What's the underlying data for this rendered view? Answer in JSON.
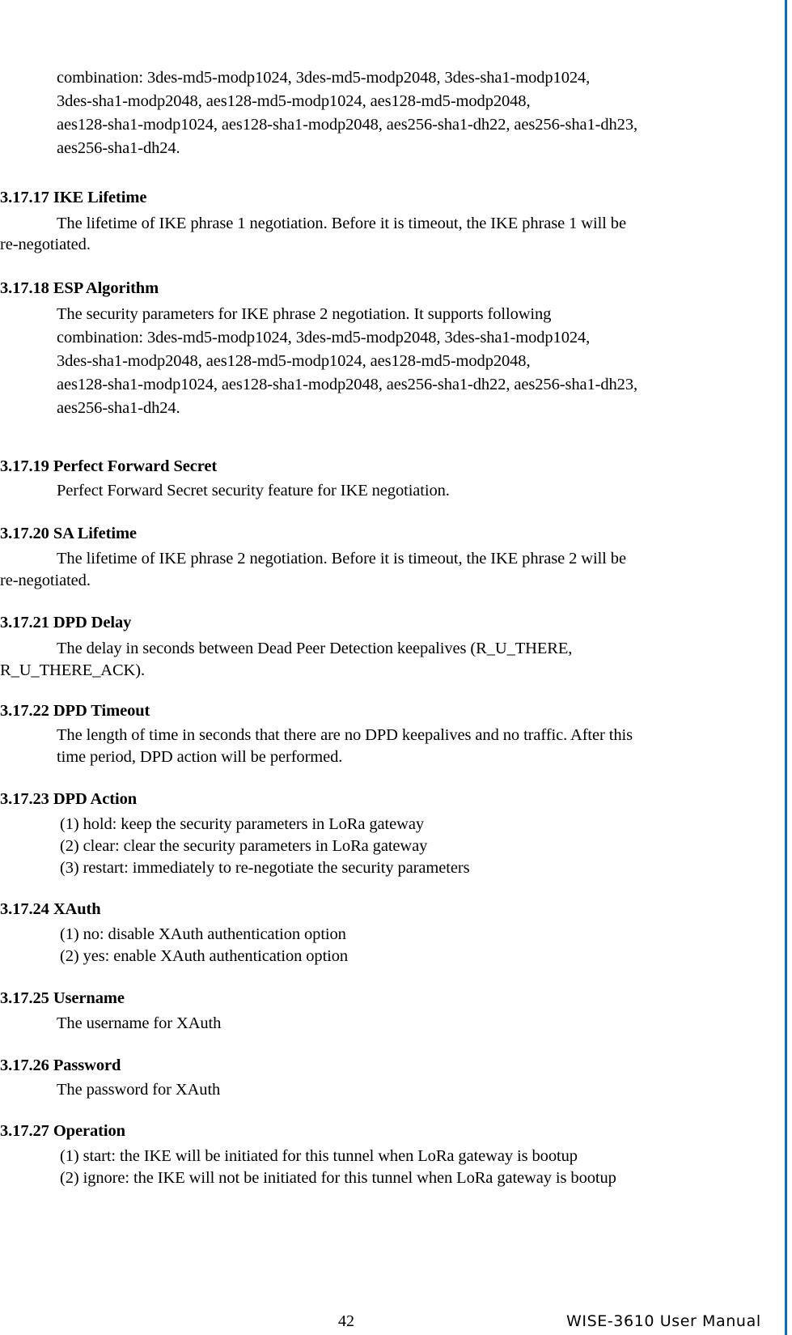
{
  "document": {
    "type": "user-manual-page",
    "page_number": "42",
    "footer_right": "WISE-3610  User  Manual",
    "accent_color": "#0b6cb7",
    "page_background": "#ffffff",
    "text_color": "#000000"
  },
  "continued_paragraph": {
    "line1": "combination:    3des-md5-modp1024,    3des-md5-modp2048,    3des-sha1-modp1024,",
    "line2": "3des-sha1-modp2048,            aes128-md5-modp1024,            aes128-md5-modp2048,",
    "line3": "aes128-sha1-modp1024, aes128-sha1-modp2048, aes256-sha1-dh22, aes256-sha1-dh23,",
    "line4": "aes256-sha1-dh24."
  },
  "sections": [
    {
      "number": "3.17.17",
      "title": "IKE Lifetime",
      "heading": "3.17.17 IKE Lifetime",
      "body_line1": "The lifetime of IKE phrase 1 negotiation. Before it is timeout, the IKE phrase 1 will be",
      "body_line2": "re-negotiated."
    },
    {
      "number": "3.17.18",
      "title": "ESP Algorithm",
      "heading": "3.17.18 ESP Algorithm",
      "body_line1": "The   security   parameters   for   IKE   phrase   2   negotiation.   It   supports   following",
      "body_line2": "combination:    3des-md5-modp1024,    3des-md5-modp2048,    3des-sha1-modp1024,",
      "body_line3": "3des-sha1-modp2048,            aes128-md5-modp1024,            aes128-md5-modp2048,",
      "body_line4": "aes128-sha1-modp1024, aes128-sha1-modp2048, aes256-sha1-dh22, aes256-sha1-dh23,",
      "body_line5": "aes256-sha1-dh24."
    },
    {
      "number": "3.17.19",
      "title": "Perfect Forward Secret",
      "heading": "3.17.19 Perfect Forward Secret",
      "body_line1": "Perfect Forward Secret security feature for IKE negotiation."
    },
    {
      "number": "3.17.20",
      "title": "SA Lifetime",
      "heading": "3.17.20 SA Lifetime",
      "body_line1": "The lifetime of IKE phrase 2 negotiation. Before it is timeout, the IKE phrase 2 will be",
      "body_line2": "re-negotiated."
    },
    {
      "number": "3.17.21",
      "title": "DPD Delay",
      "heading": "3.17.21 DPD Delay",
      "body_line1": "The delay in seconds between Dead Peer Detection keepalives (R_U_THERE,",
      "body_line2": "R_U_THERE_ACK)."
    },
    {
      "number": "3.17.22",
      "title": "DPD Timeout",
      "heading": "3.17.22 DPD Timeout",
      "body_line1": "The length of time in seconds that there are no DPD keepalives and no traffic. After this",
      "body_line2": "time period, DPD action will be performed."
    },
    {
      "number": "3.17.23",
      "title": "DPD Action",
      "heading": "3.17.23 DPD Action",
      "items": [
        "(1) hold: keep the security parameters in LoRa gateway",
        "(2) clear: clear the security parameters in LoRa gateway",
        "(3) restart: immediately to re-negotiate the security parameters"
      ]
    },
    {
      "number": "3.17.24",
      "title": "XAuth",
      "heading": "3.17.24 XAuth",
      "items": [
        "(1) no: disable XAuth authentication option",
        "(2) yes: enable XAuth authentication option"
      ]
    },
    {
      "number": "3.17.25",
      "title": "Username",
      "heading": "3.17.25 Username",
      "body_line1": "The username for XAuth"
    },
    {
      "number": "3.17.26",
      "title": "Password",
      "heading": "3.17.26 Password",
      "body_line1": "The password for XAuth"
    },
    {
      "number": "3.17.27",
      "title": "Operation",
      "heading": "3.17.27 Operation",
      "items": [
        "(1) start: the IKE will be initiated for this tunnel when LoRa gateway is bootup",
        "(2) ignore: the IKE will not be initiated for this tunnel when LoRa gateway is bootup"
      ]
    }
  ]
}
